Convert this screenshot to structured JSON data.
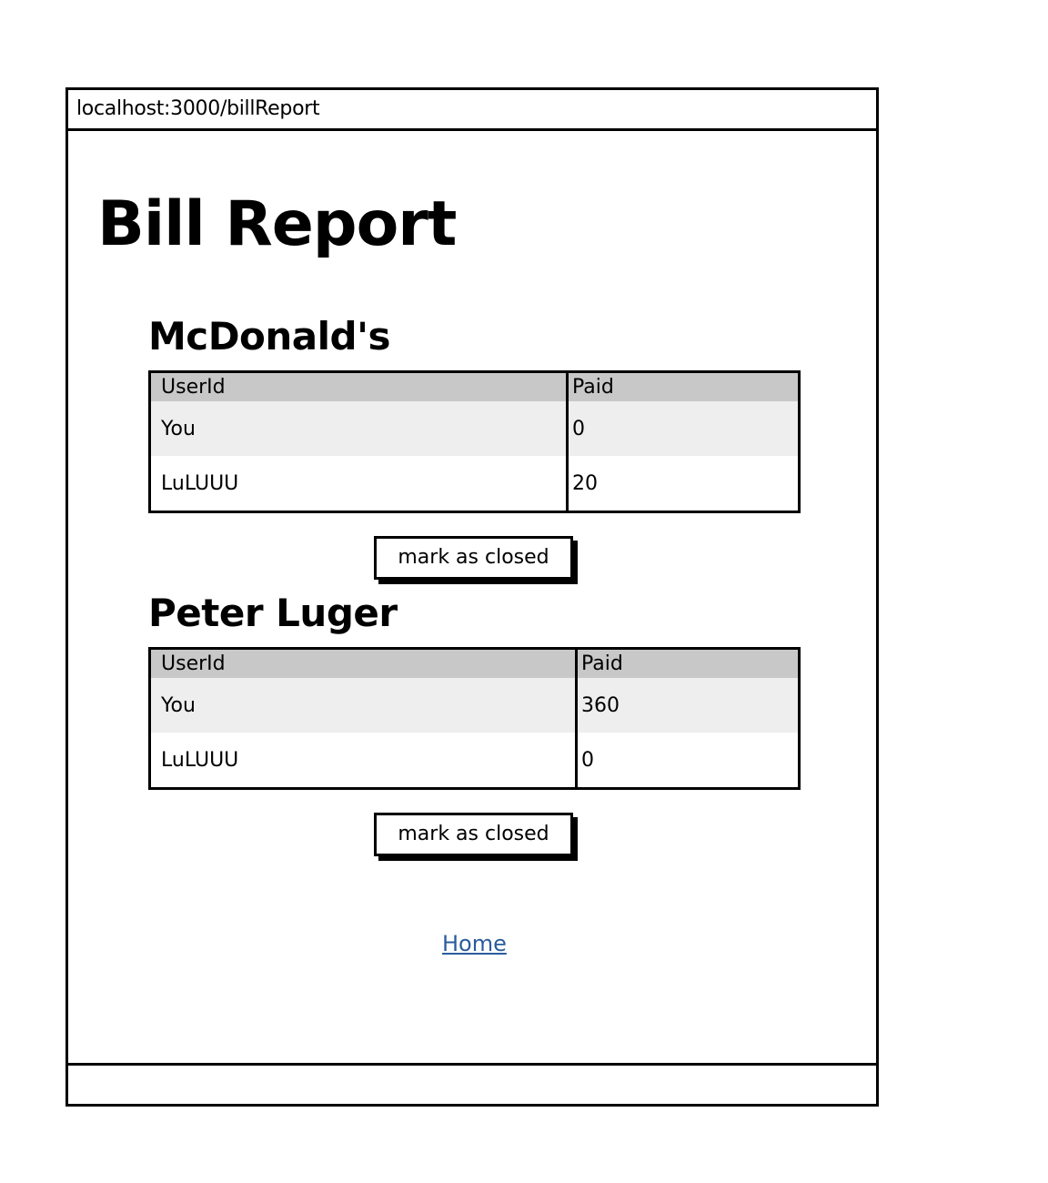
{
  "browser": {
    "url": "localhost:3000/billReport"
  },
  "page": {
    "title": "Bill Report"
  },
  "table_headers": {
    "user_id": "UserId",
    "paid": "Paid"
  },
  "bills": [
    {
      "name": "McDonald's",
      "rows": [
        {
          "user_id": "You",
          "paid": "0"
        },
        {
          "user_id": "LuLUUU",
          "paid": "20"
        }
      ],
      "action_label": "mark as closed"
    },
    {
      "name": "Peter Luger",
      "rows": [
        {
          "user_id": "You",
          "paid": "360"
        },
        {
          "user_id": "LuLUUU",
          "paid": "0"
        }
      ],
      "action_label": "mark as closed"
    }
  ],
  "footer": {
    "home_link": "Home"
  },
  "colors": {
    "header_row": "#c8c8c8",
    "shaded_row": "#eeeeee",
    "link": "#2b5c9c"
  }
}
